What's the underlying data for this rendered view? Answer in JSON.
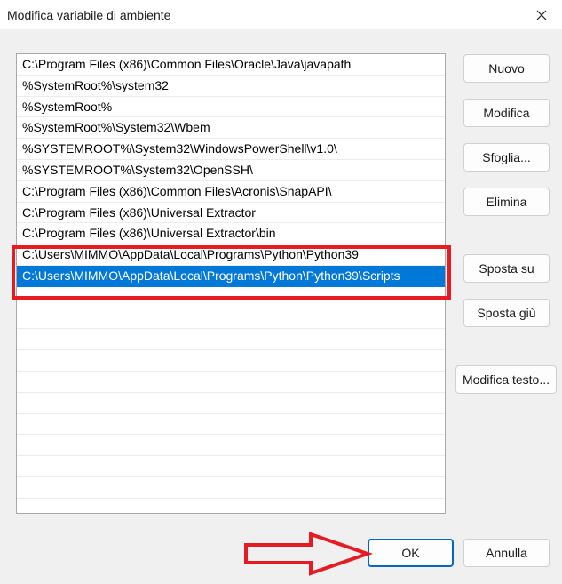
{
  "window": {
    "title": "Modifica variabile di ambiente"
  },
  "path_entries": [
    {
      "text": "C:\\Program Files (x86)\\Common Files\\Oracle\\Java\\javapath",
      "selected": false
    },
    {
      "text": "%SystemRoot%\\system32",
      "selected": false
    },
    {
      "text": "%SystemRoot%",
      "selected": false
    },
    {
      "text": "%SystemRoot%\\System32\\Wbem",
      "selected": false
    },
    {
      "text": "%SYSTEMROOT%\\System32\\WindowsPowerShell\\v1.0\\",
      "selected": false
    },
    {
      "text": "%SYSTEMROOT%\\System32\\OpenSSH\\",
      "selected": false
    },
    {
      "text": "C:\\Program Files (x86)\\Common Files\\Acronis\\SnapAPI\\",
      "selected": false
    },
    {
      "text": "C:\\Program Files (x86)\\Universal Extractor",
      "selected": false
    },
    {
      "text": "C:\\Program Files (x86)\\Universal Extractor\\bin",
      "selected": false
    },
    {
      "text": "C:\\Users\\MIMMO\\AppData\\Local\\Programs\\Python\\Python39",
      "selected": false
    },
    {
      "text": "C:\\Users\\MIMMO\\AppData\\Local\\Programs\\Python\\Python39\\Scripts",
      "selected": true
    }
  ],
  "buttons": {
    "new": "Nuovo",
    "edit": "Modifica",
    "browse": "Sfoglia...",
    "delete": "Elimina",
    "move_up": "Sposta su",
    "move_down": "Sposta giù",
    "edit_text": "Modifica testo...",
    "ok": "OK",
    "cancel": "Annulla"
  },
  "colors": {
    "selection": "#0078d7",
    "annotation": "#e51c23"
  }
}
